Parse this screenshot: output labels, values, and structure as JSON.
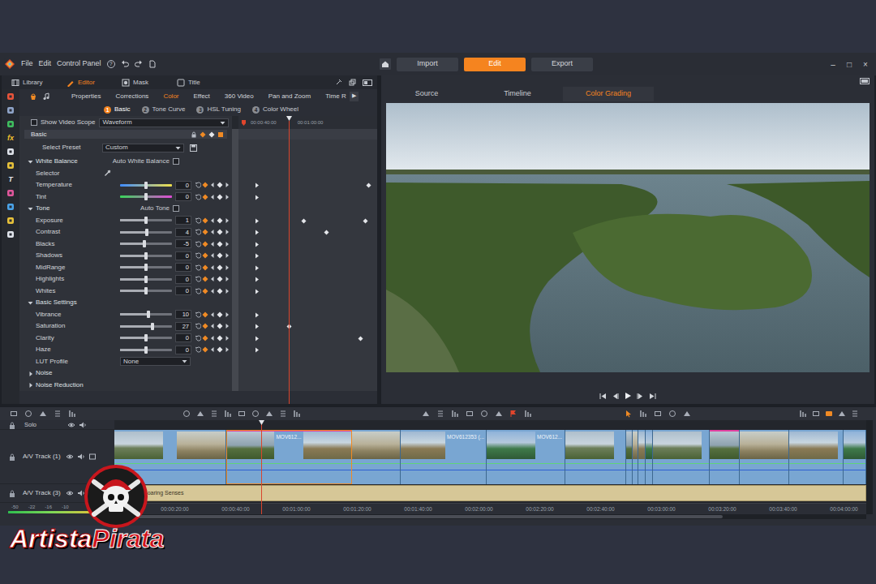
{
  "app": {
    "menu": [
      {
        "label": "File",
        "kind": "menu"
      },
      {
        "label": "Edit",
        "kind": "menu"
      },
      {
        "label": "Control Panel",
        "kind": "menu"
      },
      {
        "label": "?",
        "kind": "help"
      }
    ],
    "modes": [
      {
        "label": "Import",
        "selected": false
      },
      {
        "label": "Edit",
        "selected": true
      },
      {
        "label": "Export",
        "selected": false
      }
    ],
    "window_controls": [
      "–",
      "□",
      "×"
    ]
  },
  "editor": {
    "tabs": [
      {
        "label": "Library",
        "selected": false
      },
      {
        "label": "Editor",
        "selected": true
      },
      {
        "label": "Mask",
        "selected": false
      },
      {
        "label": "Title",
        "selected": false
      }
    ],
    "tool_strip": [
      {
        "kind": "icon",
        "color": "#e8543a"
      },
      {
        "kind": "icon",
        "color": "#8fa4c8"
      },
      {
        "kind": "icon",
        "color": "#3fbf5f"
      },
      {
        "kind": "glyph",
        "glyph": "fx",
        "color": "#f2c12e"
      },
      {
        "kind": "icon",
        "color": "#dfe3ea"
      },
      {
        "kind": "icon",
        "color": "#e8c23a"
      },
      {
        "kind": "glyph",
        "glyph": "T",
        "color": "#e6e8ec"
      },
      {
        "kind": "icon",
        "color": "#e0579b"
      },
      {
        "kind": "icon",
        "color": "#4aa3e8"
      },
      {
        "kind": "icon",
        "color": "#e8c23a"
      },
      {
        "kind": "icon",
        "color": "#dfe3ea"
      }
    ],
    "property_tabs": [
      {
        "label": "Properties",
        "selected": false
      },
      {
        "label": "Corrections",
        "selected": false
      },
      {
        "label": "Color",
        "selected": true
      },
      {
        "label": "Effect",
        "selected": false
      },
      {
        "label": "360 Video",
        "selected": false
      },
      {
        "label": "Pan and Zoom",
        "selected": false
      },
      {
        "label": "Time R",
        "selected": false
      }
    ],
    "more": "▶",
    "subtabs": [
      {
        "number": "1",
        "label": "Basic",
        "selected": true
      },
      {
        "number": "2",
        "label": "Tone Curve",
        "selected": false
      },
      {
        "number": "3",
        "label": "HSL Tuning",
        "selected": false
      },
      {
        "number": "4",
        "label": "Color Wheel",
        "selected": false
      }
    ],
    "video_scope": {
      "label": "Show Video Scope",
      "checked": false,
      "mode": "Waveform"
    },
    "keyframe_ruler": [
      "00:00:40:00",
      "00:01:00:00"
    ],
    "playhead": 0.36,
    "panel_title": "Basic",
    "preset": {
      "label": "Select Preset",
      "value": "Custom"
    },
    "rows": [
      {
        "kind": "section",
        "label": "White Balance",
        "expanded": true,
        "option": {
          "label": "Auto White Balance",
          "checked": false
        }
      },
      {
        "kind": "selector",
        "label": "Selector"
      },
      {
        "kind": "slider",
        "label": "Temperature",
        "value": "0",
        "level": 0.5,
        "keyframes": [
          0.935
        ],
        "gradient": [
          "#3f8cff",
          "#f0e04a"
        ]
      },
      {
        "kind": "slider",
        "label": "Tint",
        "value": "0",
        "level": 0.5,
        "keyframes": [],
        "gradient": [
          "#39d45a",
          "#e04ad6"
        ]
      },
      {
        "kind": "section",
        "label": "Tone",
        "expanded": true,
        "option": {
          "label": "Auto Tone",
          "checked": false
        }
      },
      {
        "kind": "slider",
        "label": "Exposure",
        "value": "1",
        "level": 0.5,
        "keyframes": [
          0.47,
          0.91
        ]
      },
      {
        "kind": "slider",
        "label": "Contrast",
        "value": "4",
        "level": 0.52,
        "keyframes": [
          0.63
        ]
      },
      {
        "kind": "slider",
        "label": "Blacks",
        "value": "-5",
        "level": 0.47,
        "keyframes": []
      },
      {
        "kind": "slider",
        "label": "Shadows",
        "value": "0",
        "level": 0.5,
        "keyframes": []
      },
      {
        "kind": "slider",
        "label": "MidRange",
        "value": "0",
        "level": 0.5,
        "keyframes": []
      },
      {
        "kind": "slider",
        "label": "Highlights",
        "value": "0",
        "level": 0.5,
        "keyframes": []
      },
      {
        "kind": "slider",
        "label": "Whites",
        "value": "0",
        "level": 0.5,
        "keyframes": []
      },
      {
        "kind": "section",
        "label": "Basic Settings",
        "expanded": true
      },
      {
        "kind": "slider",
        "label": "Vibrance",
        "value": "10",
        "level": 0.55,
        "keyframes": []
      },
      {
        "kind": "slider",
        "label": "Saturation",
        "value": "27",
        "level": 0.63,
        "keyframes": [
          0.36
        ]
      },
      {
        "kind": "slider",
        "label": "Clarity",
        "value": "0",
        "level": 0.5,
        "keyframes": [
          0.88
        ]
      },
      {
        "kind": "slider",
        "label": "Haze",
        "value": "0",
        "level": 0.5,
        "keyframes": []
      },
      {
        "kind": "dropdown",
        "label": "LUT Profile",
        "value": "None"
      },
      {
        "kind": "section",
        "label": "Noise",
        "expanded": false
      },
      {
        "kind": "section",
        "label": "Noise Reduction",
        "expanded": false
      }
    ]
  },
  "preview": {
    "tabs": [
      {
        "label": "Source",
        "selected": false
      },
      {
        "label": "Timeline",
        "selected": false
      },
      {
        "label": "Color Grading",
        "selected": true
      }
    ]
  },
  "timeline": {
    "solo": "Solo",
    "video_track": {
      "name": "A/V Track (1)",
      "clips": [
        {
          "selected": false,
          "flagged": false
        },
        {
          "label": "MOV612...",
          "selected": true,
          "flagged": true
        },
        {
          "selected": false,
          "flagged": false
        },
        {
          "label": "MOV612353 (...",
          "selected": false,
          "flagged": false
        },
        {
          "label": "MOV612...",
          "selected": false,
          "flagged": false
        },
        {
          "selected": false,
          "flagged": false
        },
        {
          "selected": false,
          "flagged": false
        },
        {
          "selected": false,
          "flagged": false
        },
        {
          "selected": false,
          "flagged": false
        },
        {
          "selected": false,
          "flagged": false
        },
        {
          "selected": false,
          "flagged": false
        },
        {
          "selected": false,
          "flagged": true
        },
        {
          "selected": false,
          "flagged": false
        },
        {
          "selected": false,
          "flagged": false
        },
        {
          "selected": false,
          "flagged": false
        }
      ]
    },
    "audio_track": {
      "name": "A/V Track (3)",
      "clip": "Soaring Senses"
    },
    "ruler": [
      "00:00:20:00",
      "00:00:40:00",
      "00:01:00:00",
      "00:01:20:00",
      "00:01:40:00",
      "00:02:00:00",
      "00:02:20:00",
      "00:02:40:00",
      "00:03:00:00",
      "00:03:20:00",
      "00:03:40:00",
      "00:04:00:00"
    ],
    "meter": {
      "scale": [
        "-50",
        "-22",
        "-16",
        "-10"
      ],
      "level": 0.85
    },
    "playhead": 0.195
  },
  "watermark": {
    "words": [
      "Artista",
      "Pirata"
    ]
  }
}
